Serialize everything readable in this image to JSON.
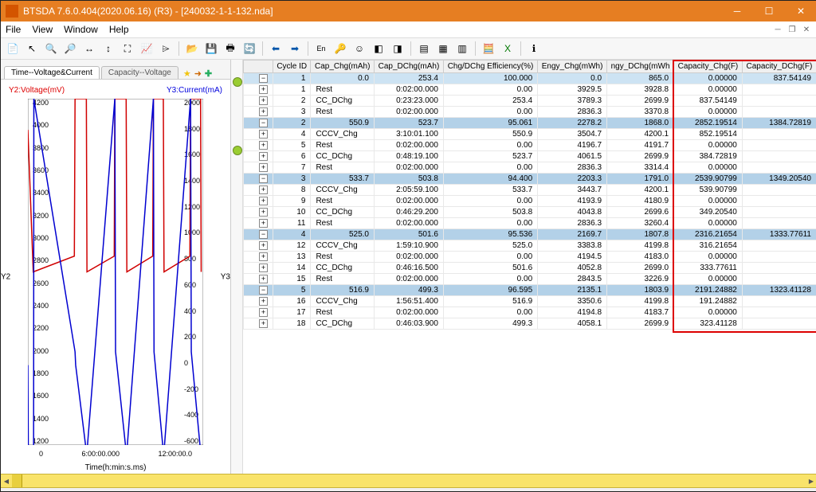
{
  "window": {
    "title": "BTSDA 7.6.0.404(2020.06.16) (R3) - [240032-1-1-132.nda]"
  },
  "menu": {
    "items": [
      "File",
      "View",
      "Window",
      "Help"
    ]
  },
  "tabs": {
    "active": "Time--Voltage&Current",
    "inactive": "Capacity--Voltage"
  },
  "chart": {
    "y2_label": "Y2:Voltage(mV)",
    "y3_label": "Y3:Current(mA)",
    "y2_axis": "Y2",
    "y3_axis": "Y3",
    "x_label": "Time(h:min:s.ms)",
    "y2_ticks": [
      "4200",
      "4000",
      "3800",
      "3600",
      "3400",
      "3200",
      "3000",
      "2800",
      "2600",
      "2400",
      "2200",
      "2000",
      "1800",
      "1600",
      "1400",
      "1200"
    ],
    "y3_ticks": [
      "2000",
      "1800",
      "1600",
      "1400",
      "1200",
      "1000",
      "800",
      "600",
      "400",
      "200",
      "0",
      "-200",
      "-400",
      "-600"
    ],
    "x_ticks": [
      "0",
      "6:00:00.000",
      "12:00:00.0"
    ]
  },
  "grid": {
    "headers": [
      "Cycle ID",
      "Cap_Chg(mAh)",
      "Cap_DChg(mAh)",
      "Chg/DChg Efficiency(%)",
      "Engy_Chg(mWh)",
      "ngy_DChg(mWh",
      "Capacity_Chg(F)",
      "Capacity_DChg(F)"
    ],
    "cycles": [
      {
        "id": "1",
        "cap_chg": "0.0",
        "cap_dchg": "253.4",
        "eff": "100.000",
        "e_chg": "0.0",
        "e_dchg": "865.0",
        "cf_chg": "0.00000",
        "cf_dchg": "837.54149",
        "steps": [
          {
            "n": "1",
            "type": "Rest",
            "t": "0:02:00.000",
            "a": "0.00",
            "b": "3929.5",
            "c": "3928.8",
            "f": "0.00000",
            "g": ""
          },
          {
            "n": "2",
            "type": "CC_DChg",
            "t": "0:23:23.000",
            "a": "253.4",
            "b": "3789.3",
            "c": "2699.9",
            "f": "837.54149",
            "g": ""
          },
          {
            "n": "3",
            "type": "Rest",
            "t": "0:02:00.000",
            "a": "0.00",
            "b": "2836.3",
            "c": "3370.8",
            "f": "0.00000",
            "g": ""
          }
        ]
      },
      {
        "id": "2",
        "cap_chg": "550.9",
        "cap_dchg": "523.7",
        "eff": "95.061",
        "e_chg": "2278.2",
        "e_dchg": "1868.0",
        "cf_chg": "2852.19514",
        "cf_dchg": "1384.72819",
        "steps": [
          {
            "n": "4",
            "type": "CCCV_Chg",
            "t": "3:10:01.100",
            "a": "550.9",
            "b": "3504.7",
            "c": "4200.1",
            "f": "852.19514",
            "g": ""
          },
          {
            "n": "5",
            "type": "Rest",
            "t": "0:02:00.000",
            "a": "0.00",
            "b": "4196.7",
            "c": "4191.7",
            "f": "0.00000",
            "g": ""
          },
          {
            "n": "6",
            "type": "CC_DChg",
            "t": "0:48:19.100",
            "a": "523.7",
            "b": "4061.5",
            "c": "2699.9",
            "f": "384.72819",
            "g": ""
          },
          {
            "n": "7",
            "type": "Rest",
            "t": "0:02:00.000",
            "a": "0.00",
            "b": "2836.3",
            "c": "3314.4",
            "f": "0.00000",
            "g": ""
          }
        ]
      },
      {
        "id": "3",
        "cap_chg": "533.7",
        "cap_dchg": "503.8",
        "eff": "94.400",
        "e_chg": "2203.3",
        "e_dchg": "1791.0",
        "cf_chg": "2539.90799",
        "cf_dchg": "1349.20540",
        "steps": [
          {
            "n": "8",
            "type": "CCCV_Chg",
            "t": "2:05:59.100",
            "a": "533.7",
            "b": "3443.7",
            "c": "4200.1",
            "f": "539.90799",
            "g": ""
          },
          {
            "n": "9",
            "type": "Rest",
            "t": "0:02:00.000",
            "a": "0.00",
            "b": "4193.9",
            "c": "4180.9",
            "f": "0.00000",
            "g": ""
          },
          {
            "n": "10",
            "type": "CC_DChg",
            "t": "0:46:29.200",
            "a": "503.8",
            "b": "4043.8",
            "c": "2699.6",
            "f": "349.20540",
            "g": ""
          },
          {
            "n": "11",
            "type": "Rest",
            "t": "0:02:00.000",
            "a": "0.00",
            "b": "2836.3",
            "c": "3260.4",
            "f": "0.00000",
            "g": ""
          }
        ]
      },
      {
        "id": "4",
        "cap_chg": "525.0",
        "cap_dchg": "501.6",
        "eff": "95.536",
        "e_chg": "2169.7",
        "e_dchg": "1807.8",
        "cf_chg": "2316.21654",
        "cf_dchg": "1333.77611",
        "steps": [
          {
            "n": "12",
            "type": "CCCV_Chg",
            "t": "1:59:10.900",
            "a": "525.0",
            "b": "3383.8",
            "c": "4199.8",
            "f": "316.21654",
            "g": ""
          },
          {
            "n": "13",
            "type": "Rest",
            "t": "0:02:00.000",
            "a": "0.00",
            "b": "4194.5",
            "c": "4183.0",
            "f": "0.00000",
            "g": ""
          },
          {
            "n": "14",
            "type": "CC_DChg",
            "t": "0:46:16.500",
            "a": "501.6",
            "b": "4052.8",
            "c": "2699.0",
            "f": "333.77611",
            "g": ""
          },
          {
            "n": "15",
            "type": "Rest",
            "t": "0:02:00.000",
            "a": "0.00",
            "b": "2843.5",
            "c": "3226.9",
            "f": "0.00000",
            "g": ""
          }
        ]
      },
      {
        "id": "5",
        "cap_chg": "516.9",
        "cap_dchg": "499.3",
        "eff": "96.595",
        "e_chg": "2135.1",
        "e_dchg": "1803.9",
        "cf_chg": "2191.24882",
        "cf_dchg": "1323.41128",
        "steps": [
          {
            "n": "16",
            "type": "CCCV_Chg",
            "t": "1:56:51.400",
            "a": "516.9",
            "b": "3350.6",
            "c": "4199.8",
            "f": "191.24882",
            "g": ""
          },
          {
            "n": "17",
            "type": "Rest",
            "t": "0:02:00.000",
            "a": "0.00",
            "b": "4194.8",
            "c": "4183.7",
            "f": "0.00000",
            "g": ""
          },
          {
            "n": "18",
            "type": "CC_DChg",
            "t": "0:46:03.900",
            "a": "499.3",
            "b": "4058.1",
            "c": "2699.9",
            "f": "323.41128",
            "g": ""
          }
        ]
      }
    ]
  },
  "chart_data": {
    "type": "line",
    "x_unit": "h",
    "series": [
      {
        "name": "Voltage(mV)",
        "axis": "Y2",
        "color": "#d00000",
        "x": [
          0,
          0.4,
          3.5,
          3.55,
          4.4,
          4.45,
          6.5,
          6.55,
          7.4,
          7.45,
          9.4,
          9.45,
          10.2,
          10.25,
          12.2,
          12.25,
          13.0,
          13.05
        ],
        "y": [
          3930,
          2700,
          2836,
          4200,
          4200,
          2700,
          2836,
          4200,
          4200,
          2700,
          2836,
          4200,
          4200,
          2700,
          2836,
          4200,
          4200,
          2700
        ]
      },
      {
        "name": "Current(mA)",
        "axis": "Y3",
        "color": "#0000d0",
        "x": [
          0,
          0.03,
          0.43,
          0.45,
          3.55,
          3.6,
          4.4,
          4.45,
          6.55,
          6.6,
          7.4,
          7.45,
          9.45,
          9.5,
          10.2,
          10.25,
          12.25,
          12.3,
          13.0,
          13.05
        ],
        "y": [
          0,
          -650,
          -650,
          2000,
          100,
          0,
          -650,
          -650,
          2000,
          100,
          -650,
          -650,
          2000,
          100,
          -650,
          -650,
          2000,
          100,
          -650,
          -650
        ]
      }
    ],
    "y2_range": [
      1200,
      4200
    ],
    "y3_range": [
      -600,
      2000
    ],
    "x_range": [
      0,
      13.2
    ]
  }
}
